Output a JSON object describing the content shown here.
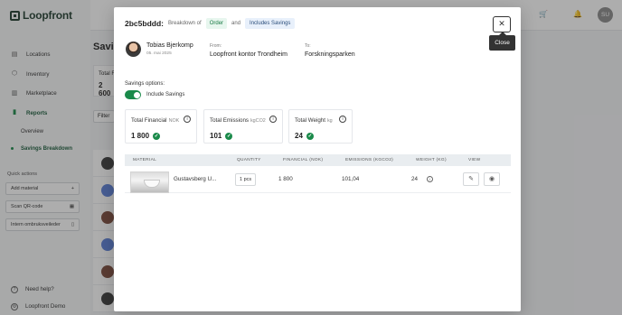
{
  "app": {
    "logo_text": "Loopfront"
  },
  "sidebar": {
    "items": [
      {
        "label": "Locations",
        "icon": "file-icon"
      },
      {
        "label": "Inventory",
        "icon": "box-icon"
      },
      {
        "label": "Marketplace",
        "icon": "store-icon"
      },
      {
        "label": "Reports",
        "icon": "chart-icon",
        "active": true
      }
    ],
    "sub_items": [
      {
        "label": "Overview"
      },
      {
        "label": "Savings Breakdown",
        "active": true
      }
    ],
    "quick_actions_title": "Quick actions",
    "quick_actions": [
      {
        "label": "Add material",
        "icon": "plus-icon"
      },
      {
        "label": "Scan QR-code",
        "icon": "qr-icon"
      },
      {
        "label": "Intern ombruksveileder",
        "icon": "book-icon"
      }
    ],
    "help_label": "Need help?",
    "org_label": "Loopfront Demo"
  },
  "topbar": {
    "avatar_initials": "SU"
  },
  "background": {
    "page_title": "Savi",
    "card_label": "Total F",
    "card_value": "2 600",
    "filter_label": "Filter"
  },
  "modal": {
    "id": "2bc5bddd:",
    "breakdown_of": "Breakdown of",
    "type_badge": "Order",
    "and_text": "and",
    "savings_badge": "Includes Savings",
    "close_tooltip": "Close",
    "person": {
      "name": "Tobias Bjerkomp",
      "date": "05. mai 2025"
    },
    "from": {
      "label": "From:",
      "value": "Loopfront kontor Trondheim"
    },
    "to": {
      "label": "To:",
      "value": "Forskningsparken"
    },
    "savings_options_label": "Savings options:",
    "include_savings_label": "Include Savings",
    "include_savings_on": true,
    "stats": [
      {
        "title": "Total Financial",
        "unit": "NOK",
        "value": "1 800"
      },
      {
        "title": "Total Emissions",
        "unit": "kgCO2",
        "value": "101"
      },
      {
        "title": "Total Weight",
        "unit": "kg",
        "value": "24"
      }
    ],
    "table": {
      "headers": [
        "MATERIAL",
        "QUANTITY",
        "FINANCIAL (NOK)",
        "EMISSIONS (KGCO2)",
        "WEIGHT (KG)",
        "VIEW"
      ],
      "rows": [
        {
          "material": "Gustavsberg U...",
          "quantity": "1 pcs",
          "financial": "1 800",
          "emissions": "101,04",
          "weight": "24"
        }
      ]
    }
  },
  "colors": {
    "brand_green": "#1a8a4a",
    "logo_dark": "#1f3d2e"
  }
}
